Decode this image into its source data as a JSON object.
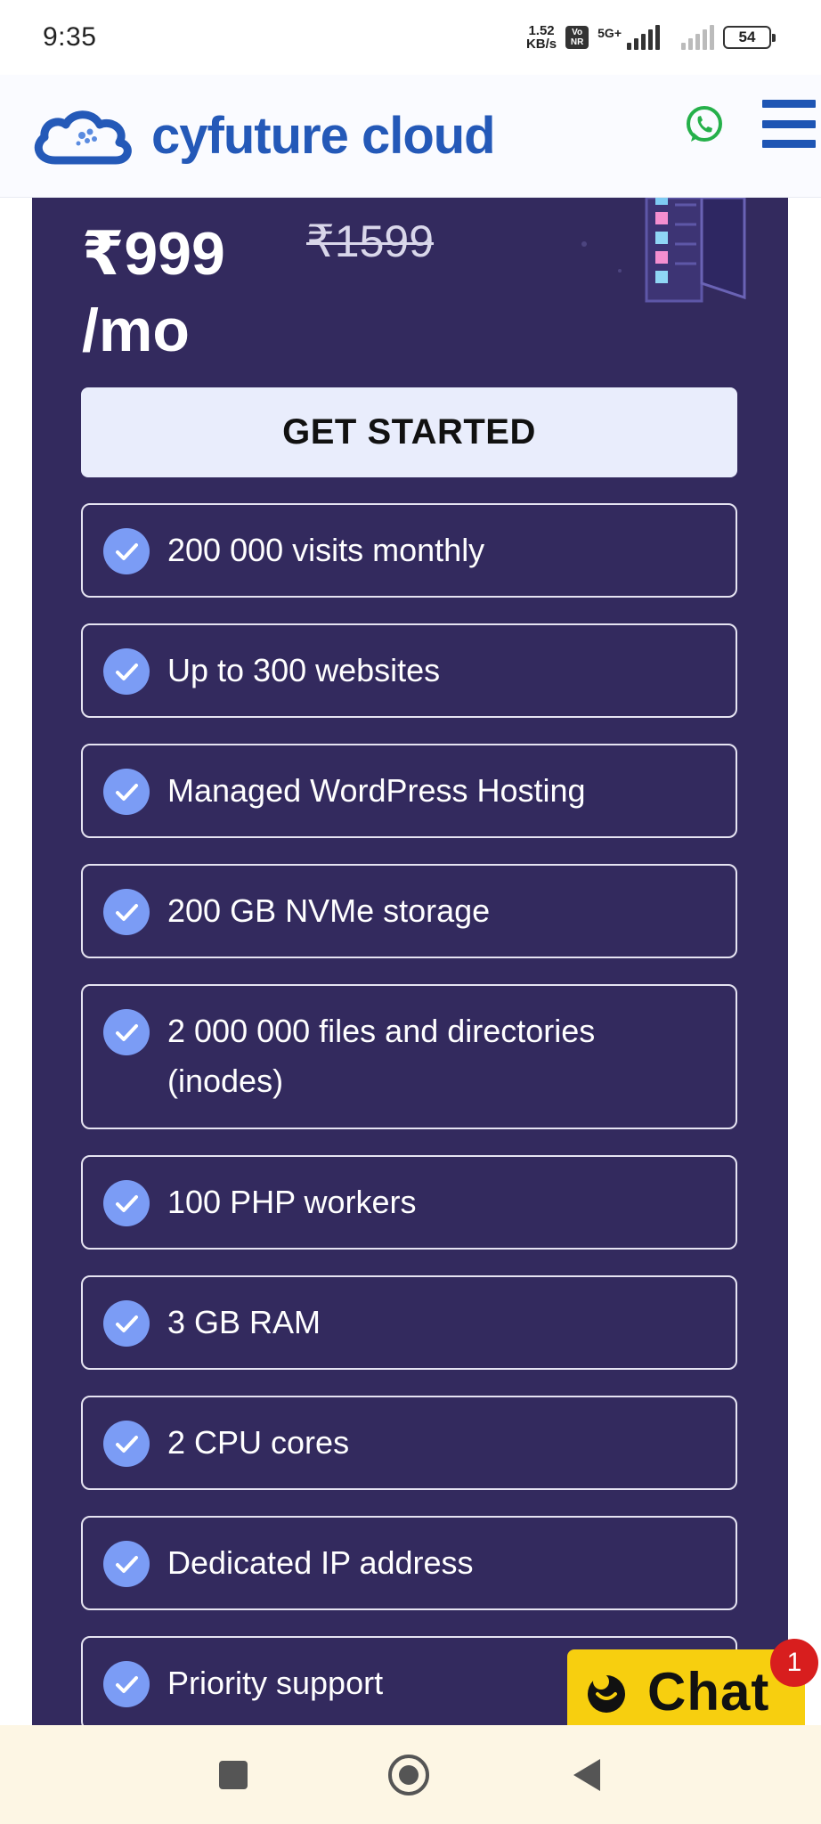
{
  "status_bar": {
    "time": "9:35",
    "net_speed_value": "1.52",
    "net_speed_unit": "KB/s",
    "volte_label": "Vo NR",
    "network_type": "5G+",
    "battery": "54"
  },
  "header": {
    "logo_text": "cyfuture cloud",
    "brand_color": "#2459b8",
    "whatsapp_icon": "whatsapp-icon",
    "menu_icon": "hamburger-menu-icon"
  },
  "plan": {
    "price": "₹999",
    "period": "/mo",
    "original_price": "₹1599",
    "cta_label": "GET STARTED",
    "card_color": "#332a5e",
    "features": [
      "200 000 visits monthly",
      "Up to 300 websites",
      "Managed WordPress Hosting",
      "200 GB NVMe storage",
      "2 000 000 files and directories (inodes)",
      "100 PHP workers",
      "3 GB RAM",
      "2 CPU cores",
      "Dedicated IP address",
      "Priority support"
    ]
  },
  "chat": {
    "label": "Chat",
    "badge_count": "1",
    "color": "#f7cf0f"
  },
  "nav": {
    "recents_icon": "square-icon",
    "home_icon": "home-circle-icon",
    "back_icon": "back-triangle-icon"
  }
}
